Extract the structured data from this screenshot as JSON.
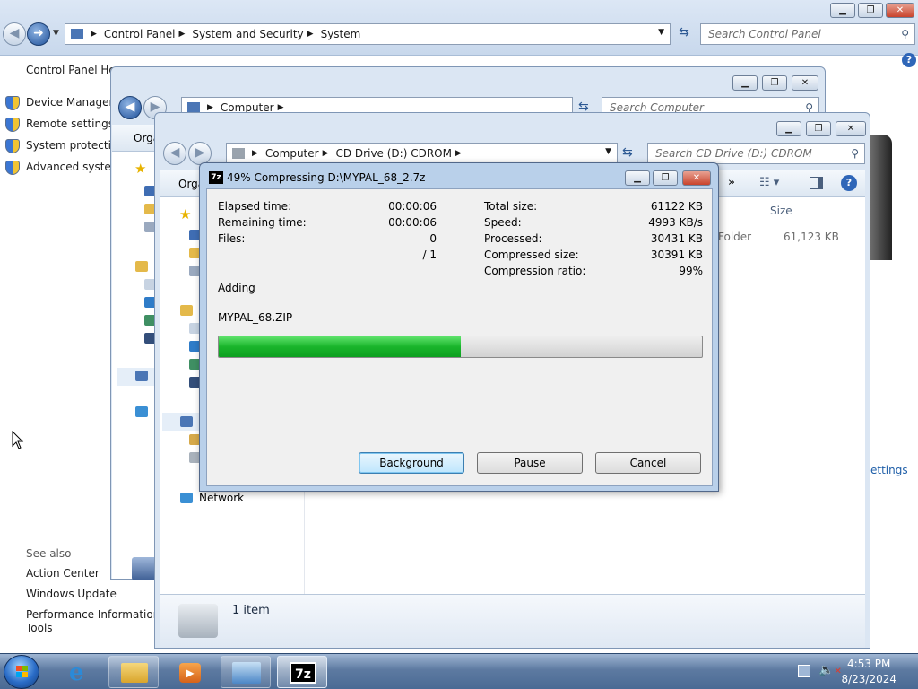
{
  "control_panel": {
    "breadcrumb": [
      "Control Panel",
      "System and Security",
      "System"
    ],
    "search_placeholder": "Search Control Panel",
    "left_nav": {
      "home": "Control Panel Ho",
      "items": [
        "Device Manager",
        "Remote settings",
        "System protection",
        "Advanced system"
      ],
      "see_also_heading": "See also",
      "see_also": [
        "Action Center",
        "Windows Update",
        "Performance Information a",
        "Tools"
      ]
    },
    "partial_link": "ettings",
    "help_icon": "help-icon"
  },
  "computer_window": {
    "breadcrumb": [
      "Computer"
    ],
    "search_placeholder": "Search Computer",
    "organize": "Orga"
  },
  "cd_window": {
    "breadcrumb": [
      "Computer",
      "CD Drive (D:) CDROM"
    ],
    "search_placeholder": "Search CD Drive (D:) CDROM",
    "organize": "Orga",
    "column_size": "Size",
    "file_type_partial": "Folder",
    "file_size": "61,123 KB",
    "network_label": "Network",
    "status_items": "1 item"
  },
  "dialog": {
    "title": "49% Compressing D:\\MYPAL_68_2.7z",
    "logo": "7z",
    "left_stats": [
      {
        "label": "Elapsed time:",
        "value": "00:00:06"
      },
      {
        "label": "Remaining time:",
        "value": "00:00:06"
      },
      {
        "label": "Files:",
        "value": "0"
      },
      {
        "label": "",
        "value": "/ 1"
      }
    ],
    "right_stats": [
      {
        "label": "Total size:",
        "value": "61122 KB"
      },
      {
        "label": "Speed:",
        "value": "4993 KB/s"
      },
      {
        "label": "Processed:",
        "value": "30431 KB"
      },
      {
        "label": "Compressed size:",
        "value": "30391 KB"
      },
      {
        "label": "Compression ratio:",
        "value": "99%"
      }
    ],
    "action": "Adding",
    "current_file": "MYPAL_68.ZIP",
    "progress": 0.5,
    "buttons": {
      "background": "Background",
      "pause": "Pause",
      "cancel": "Cancel"
    }
  },
  "taskbar": {
    "items": [
      "ie-icon",
      "explorer-icon",
      "media-player-icon",
      "control-panel-icon",
      "7zip-icon"
    ],
    "time": "4:53 PM",
    "date": "8/23/2024"
  },
  "colors": {
    "progress_green": "#19b52b",
    "titlebar": "#c8d8ec",
    "taskbar": "#4a6a94"
  }
}
